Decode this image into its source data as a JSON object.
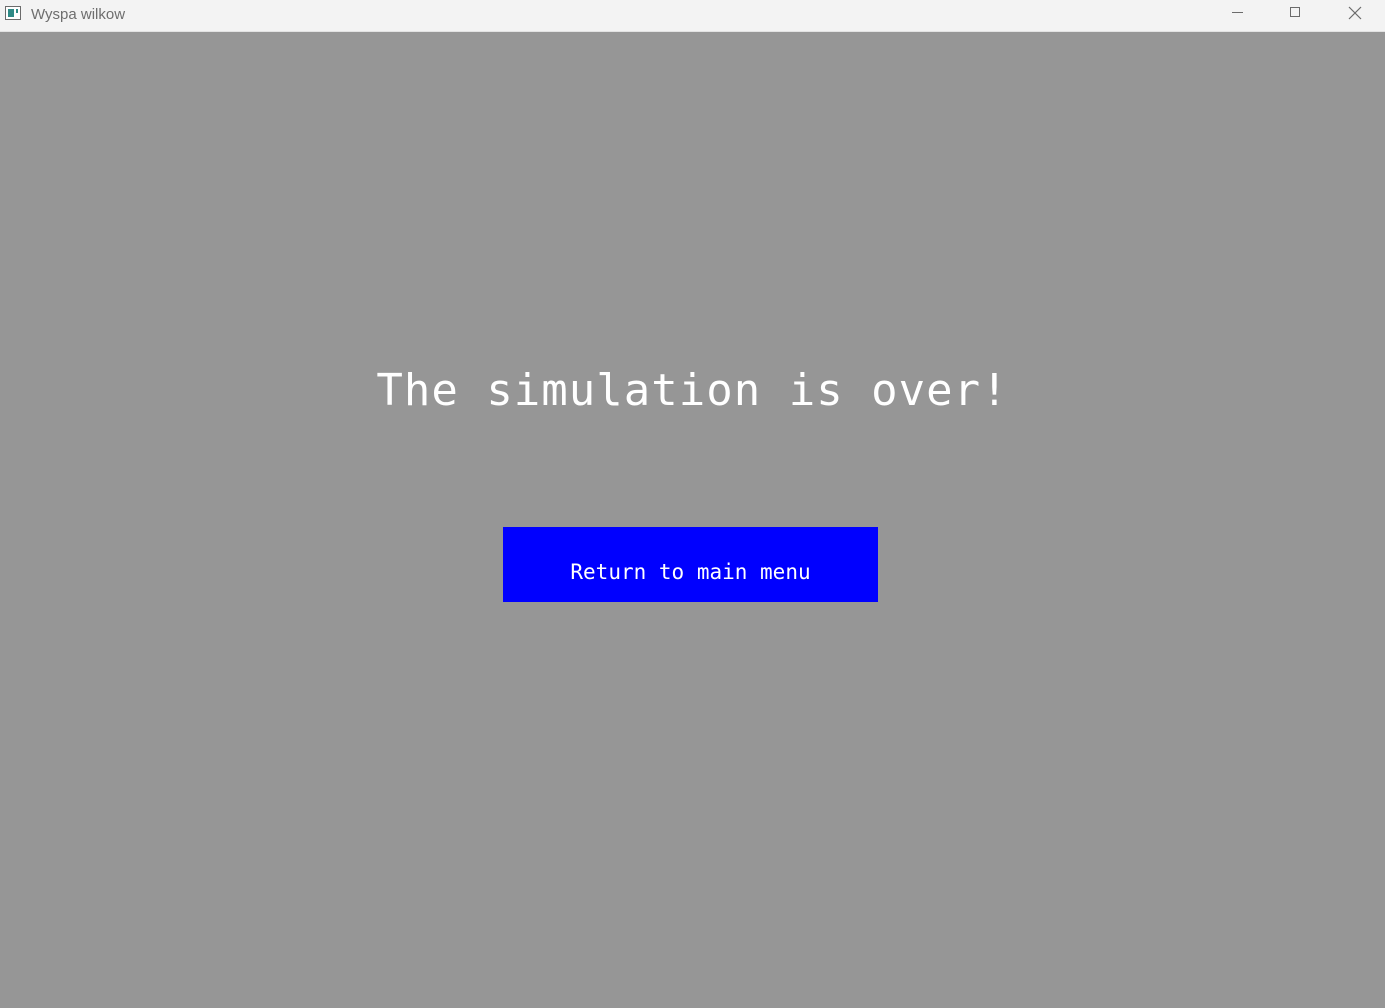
{
  "window": {
    "title": "Wyspa wilkow",
    "icon": "app-window-icon",
    "controls": {
      "minimize_icon": "minimize-icon",
      "maximize_icon": "maximize-icon",
      "close_icon": "close-icon"
    }
  },
  "main": {
    "headline": "The simulation is over!",
    "return_button_label": "Return to main menu"
  },
  "colors": {
    "background": "#969696",
    "titlebar": "#f3f3f3",
    "button": "#0000ff",
    "text": "#ffffff"
  }
}
